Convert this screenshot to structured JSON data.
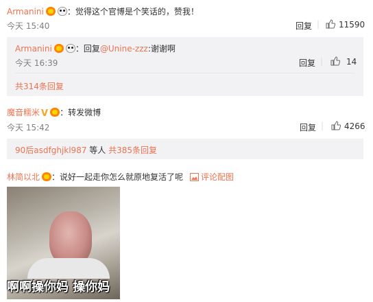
{
  "comment1": {
    "user": "Armanini",
    "text": "：觉得这个官博是个笑话的，赞我！",
    "time": "今天 15:40",
    "reply_label": "回复",
    "likes": "11590",
    "sub_reply": {
      "user": "Armanini",
      "prefix": "：回复",
      "mention": "@Unine-zzz",
      "text": ":谢谢啊",
      "time": "今天 16:39",
      "reply_label": "回复",
      "likes": "14"
    },
    "more_replies": "共314条回复"
  },
  "comment2": {
    "user": "魔音糯米",
    "text": "：转发微博",
    "time": "今天 15:42",
    "reply_label": "回复",
    "likes": "4266",
    "replies_summary": {
      "user": "90后asdfghjkl987",
      "middle": " 等人 ",
      "count": "共385条回复"
    }
  },
  "comment3": {
    "user": "林简以北",
    "text": "：说好一起走你怎么就原地复活了呢",
    "image_label": "评论配图",
    "gif_caption": "啊啊操你妈 操你妈"
  },
  "icons": {
    "badge": "crown-badge-icon",
    "panda": "panda-emoji-icon",
    "vip": "vip-v-icon",
    "thumb": "thumb-up-icon",
    "image": "image-icon"
  }
}
